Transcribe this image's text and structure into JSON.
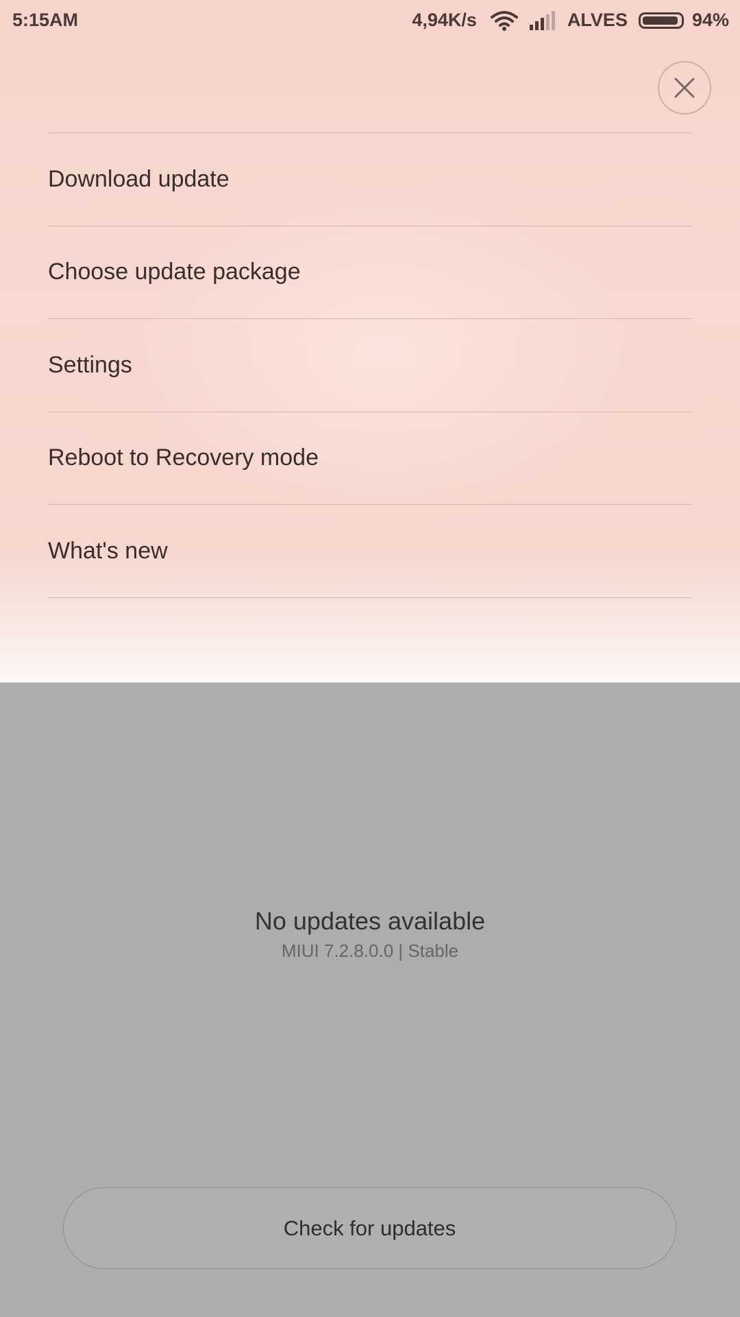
{
  "status_bar": {
    "time": "5:15AM",
    "network_speed": "4,94K/s",
    "wifi_icon": "wifi-icon",
    "signal_icon": "signal-icon",
    "carrier": "ALVES",
    "battery_icon": "battery-icon",
    "battery_percent": "94%",
    "battery_level": 0.94
  },
  "menu": {
    "close_icon": "close-icon",
    "items": [
      {
        "label": "Download update"
      },
      {
        "label": "Choose update package"
      },
      {
        "label": "Settings"
      },
      {
        "label": "Reboot to Recovery mode"
      },
      {
        "label": "What's new"
      }
    ]
  },
  "main": {
    "status_title": "No updates available",
    "status_subtitle": "MIUI 7.2.8.0.0 | Stable",
    "check_button_label": "Check for updates"
  },
  "colors": {
    "menu_background": "#f6d4cb",
    "dim_overlay": "#adadad",
    "divider": "#d8b3ab",
    "text_primary": "#3a2e2c"
  }
}
